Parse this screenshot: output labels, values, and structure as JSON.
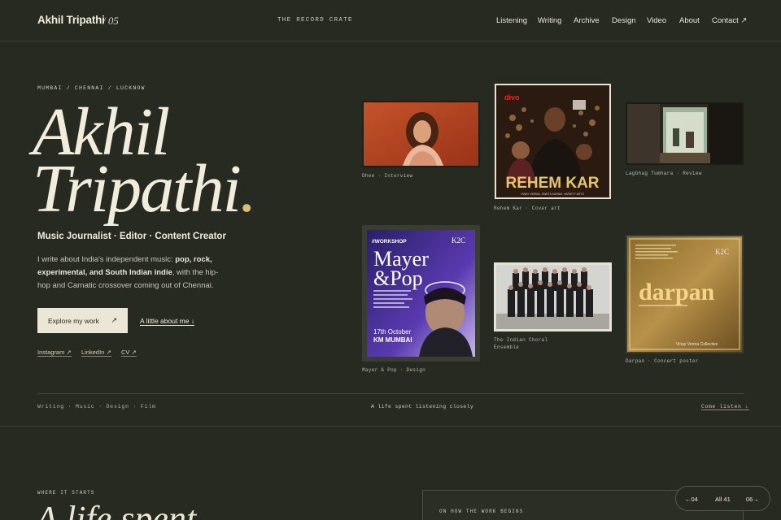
{
  "header": {
    "logo": "Akhil Tripathi",
    "logo_num": "/ 05",
    "tagline": "THE RECORD CRATE",
    "nav": [
      "Listening",
      "Writing",
      "Archive",
      "Design",
      "Video",
      "About",
      "Contact ↗"
    ]
  },
  "hero": {
    "location": "MUMBAI / CHENNAI / LUCKNOW",
    "first_name": "Akhil",
    "last_name": "Tripathi",
    "dot": ".",
    "role": "Music Journalist · Editor · Content Creator",
    "intro_1": "I write about India's independent music: ",
    "intro_bold": "pop, rock, experimental, and South Indian indie",
    "intro_2": ", with the hip-hop and Carnatic crossover coming out of Chennai.",
    "cta_label": "Explore my work",
    "cta_arrow": "↗",
    "about_link": "A little about me ↓",
    "social": [
      "Instagram ↗",
      "LinkedIn ↗",
      "CV ↗"
    ]
  },
  "tiles": {
    "dhee": {
      "caption": "Dhee · Interview"
    },
    "rehem": {
      "caption": "Rehem Kar · Cover art",
      "title": "REHEM KAR",
      "brand": "divo",
      "credits": "VINAY VERMA, SWETA KARAM, VARIETY ARTS"
    },
    "lagbhag": {
      "caption": "Lagbhag Tumhara · Review"
    },
    "mayer": {
      "caption": "Mayer & Pop · Design",
      "tag": "//WORKSHOP",
      "title_1": "Mayer",
      "title_2": "&Pop",
      "logo": "K2C",
      "date": "17th October",
      "venue": "KM MUMBAI"
    },
    "choral": {
      "caption": "The Indian Choral Ensemble"
    },
    "darpan": {
      "caption": "Darpan · Concert poster",
      "title": "darpan",
      "logo": "K2C",
      "footer": "Vinay Verma Collective"
    }
  },
  "band": {
    "tags": "Writing · Music · Design · Film",
    "center": "A life spent listening closely",
    "come": "Come listen ↓"
  },
  "section2": {
    "eyebrow": "WHERE IT STARTS",
    "heading": "A life spent",
    "card_title": "ON HOW THE WORK BEGINS"
  },
  "pager": {
    "prev": "←04",
    "all": "All 41",
    "next": "06→"
  },
  "colors": {
    "background": "#272a21",
    "text": "#ece6d6",
    "accent": "#d8bc7c"
  }
}
